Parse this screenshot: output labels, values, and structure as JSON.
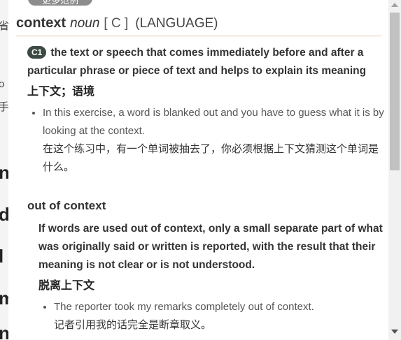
{
  "more_tab_label": "更多范例",
  "entry": {
    "headword": "context",
    "pos": "noun",
    "grammar": "[ C ]",
    "domain": "(LANGUAGE)"
  },
  "sense": {
    "level": "C1",
    "definition": "the text or speech that comes immediately before and after a particular phrase or piece of text and helps to explain its meaning",
    "translation": "上下文；语境",
    "examples": [
      {
        "en": "In this exercise, a word is blanked out and you have to guess what it is by looking at the context.",
        "cn": "在这个练习中，有一个单词被抽去了，你必须根据上下文猜测这个单词是什么。"
      }
    ]
  },
  "idiom": {
    "phrase": "out of context",
    "definition": "If words are used out of context, only a small separate part of what was originally said or written is reported, with the result that their meaning is not clear or is not understood.",
    "translation": "脱离上下文",
    "examples": [
      {
        "en": "The reporter took my remarks completely out of context.",
        "cn": "记者引用我的话完全是断章取义。"
      }
    ]
  },
  "background_fragments": [
    "省",
    "o",
    "手",
    "n",
    "d",
    "l",
    "m",
    "n"
  ]
}
